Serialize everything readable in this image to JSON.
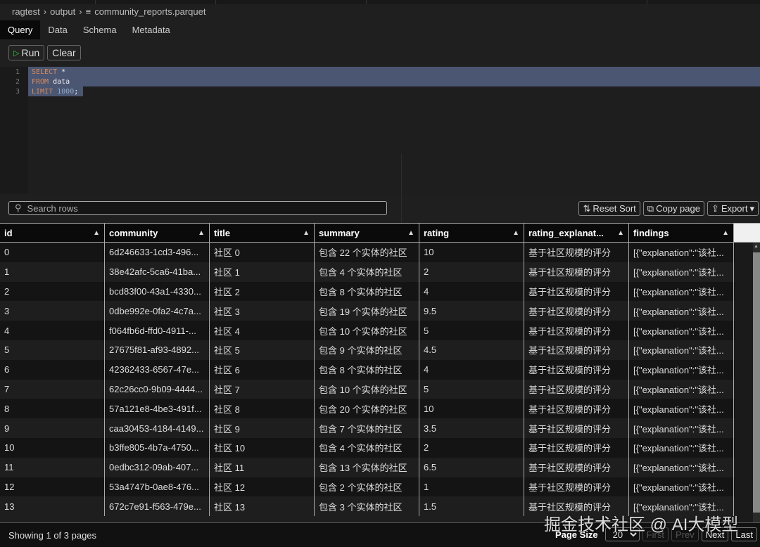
{
  "breadcrumb": [
    "ragtest",
    "output",
    "community_reports.parquet"
  ],
  "tabs": [
    "Query",
    "Data",
    "Schema",
    "Metadata"
  ],
  "toolbar": {
    "run": "Run",
    "clear": "Clear"
  },
  "editor": {
    "lines": [
      "1",
      "2",
      "3"
    ],
    "kw1": "SELECT",
    "star": " *",
    "kw2": "FROM",
    "tbl": " data",
    "kw3": "LIMIT",
    "num": " 1000",
    ";": ";"
  },
  "search": {
    "placeholder": "Search rows"
  },
  "actions": {
    "reset_sort": "Reset Sort",
    "copy_page": "Copy page",
    "export": "Export"
  },
  "columns": [
    "id",
    "community",
    "title",
    "summary",
    "rating",
    "rating_explanat...",
    "findings"
  ],
  "rows": [
    [
      "0",
      "6d246633-1cd3-496...",
      "社区 0",
      "包含 22 个实体的社区",
      "10",
      "基于社区规模的评分",
      "[{\"explanation\":\"该社..."
    ],
    [
      "1",
      "38e42afc-5ca6-41ba...",
      "社区 1",
      "包含 4 个实体的社区",
      "2",
      "基于社区规模的评分",
      "[{\"explanation\":\"该社..."
    ],
    [
      "2",
      "bcd83f00-43a1-4330...",
      "社区 2",
      "包含 8 个实体的社区",
      "4",
      "基于社区规模的评分",
      "[{\"explanation\":\"该社..."
    ],
    [
      "3",
      "0dbe992e-0fa2-4c7a...",
      "社区 3",
      "包含 19 个实体的社区",
      "9.5",
      "基于社区规模的评分",
      "[{\"explanation\":\"该社..."
    ],
    [
      "4",
      "f064fb6d-ffd0-4911-...",
      "社区 4",
      "包含 10 个实体的社区",
      "5",
      "基于社区规模的评分",
      "[{\"explanation\":\"该社..."
    ],
    [
      "5",
      "27675f81-af93-4892...",
      "社区 5",
      "包含 9 个实体的社区",
      "4.5",
      "基于社区规模的评分",
      "[{\"explanation\":\"该社..."
    ],
    [
      "6",
      "42362433-6567-47e...",
      "社区 6",
      "包含 8 个实体的社区",
      "4",
      "基于社区规模的评分",
      "[{\"explanation\":\"该社..."
    ],
    [
      "7",
      "62c26cc0-9b09-4444...",
      "社区 7",
      "包含 10 个实体的社区",
      "5",
      "基于社区规模的评分",
      "[{\"explanation\":\"该社..."
    ],
    [
      "8",
      "57a121e8-4be3-491f...",
      "社区 8",
      "包含 20 个实体的社区",
      "10",
      "基于社区规模的评分",
      "[{\"explanation\":\"该社..."
    ],
    [
      "9",
      "caa30453-4184-4149...",
      "社区 9",
      "包含 7 个实体的社区",
      "3.5",
      "基于社区规模的评分",
      "[{\"explanation\":\"该社..."
    ],
    [
      "10",
      "b3ffe805-4b7a-4750...",
      "社区 10",
      "包含 4 个实体的社区",
      "2",
      "基于社区规模的评分",
      "[{\"explanation\":\"该社..."
    ],
    [
      "11",
      "0edbc312-09ab-407...",
      "社区 11",
      "包含 13 个实体的社区",
      "6.5",
      "基于社区规模的评分",
      "[{\"explanation\":\"该社..."
    ],
    [
      "12",
      "53a4747b-0ae8-476...",
      "社区 12",
      "包含 2 个实体的社区",
      "1",
      "基于社区规模的评分",
      "[{\"explanation\":\"该社..."
    ],
    [
      "13",
      "672c7e91-f563-479e...",
      "社区 13",
      "包含 3 个实体的社区",
      "1.5",
      "基于社区规模的评分",
      "[{\"explanation\":\"该社..."
    ]
  ],
  "footer": {
    "showing": "Showing 1 of 3 pages",
    "page_size_label": "Page Size",
    "page_size": "20",
    "first": "First",
    "prev": "Prev",
    "next": "Next",
    "last": "Last"
  },
  "watermark": "掘金技术社区 @ AI大模型"
}
